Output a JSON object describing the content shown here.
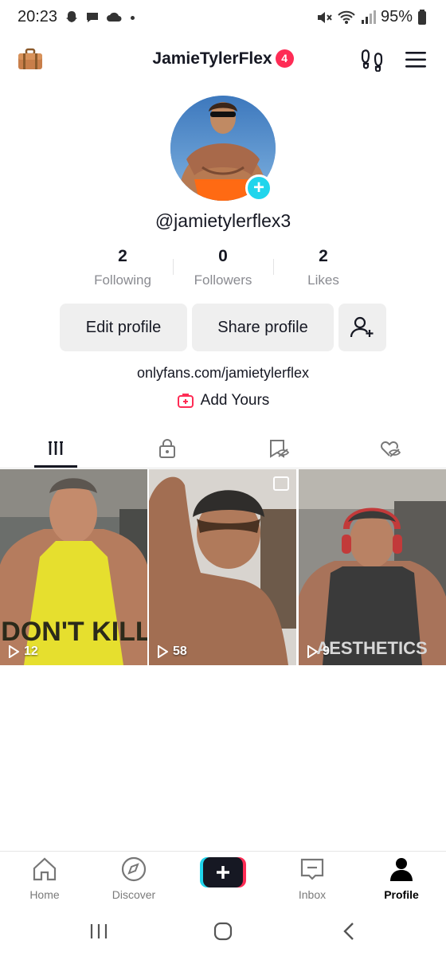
{
  "status_bar": {
    "time": "20:23",
    "battery": "95%"
  },
  "header": {
    "username": "JamieTylerFlex",
    "notification_count": "4"
  },
  "profile": {
    "handle": "@jamietylerflex3",
    "stats": [
      {
        "value": "2",
        "label": "Following"
      },
      {
        "value": "0",
        "label": "Followers"
      },
      {
        "value": "2",
        "label": "Likes"
      }
    ],
    "edit_label": "Edit profile",
    "share_label": "Share profile",
    "bio_link": "onlyfans.com/jamietylerflex",
    "add_yours_label": "Add Yours"
  },
  "videos": [
    {
      "views": "12",
      "shirt_text": "DON'T KILL"
    },
    {
      "views": "58"
    },
    {
      "views": "9",
      "shirt_text": "AESTHETICS"
    }
  ],
  "bottom_nav": {
    "items": [
      {
        "label": "Home"
      },
      {
        "label": "Discover"
      },
      {
        "label": "Inbox"
      },
      {
        "label": "Profile"
      }
    ]
  },
  "colors": {
    "accent_red": "#fe2c55",
    "accent_cyan": "#20d5ec"
  }
}
